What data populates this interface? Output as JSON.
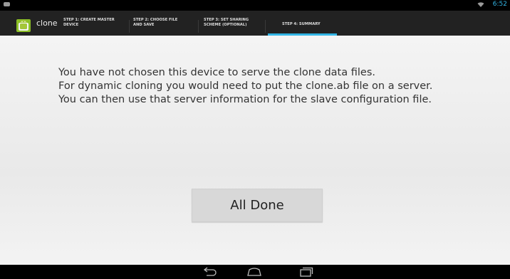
{
  "status_bar": {
    "time": "6:52"
  },
  "action_bar": {
    "app_title": "clone",
    "tabs": [
      {
        "label_line1": "STEP 1: CREATE MASTER",
        "label_line2": "DEVICE"
      },
      {
        "label_line1": "STEP 2: CHOOSE FILE",
        "label_line2": "AND SAVE"
      },
      {
        "label_line1": "STEP 3: SET SHARING",
        "label_line2": "SCHEME (OPTIONAL)"
      },
      {
        "label_line1": "STEP 4: SUMMARY",
        "selected": true
      }
    ],
    "accent_color": "#33b5e5"
  },
  "main": {
    "message_lines": [
      "You have not chosen this device to serve the clone data files.",
      "For dynamic cloning you would need to put the clone.ab file on a server.",
      "You can then use that server information for the slave configuration file."
    ],
    "button_label": "All Done"
  },
  "nav_bar": {
    "icons": [
      "back-icon",
      "home-icon",
      "recent-apps-icon"
    ]
  }
}
